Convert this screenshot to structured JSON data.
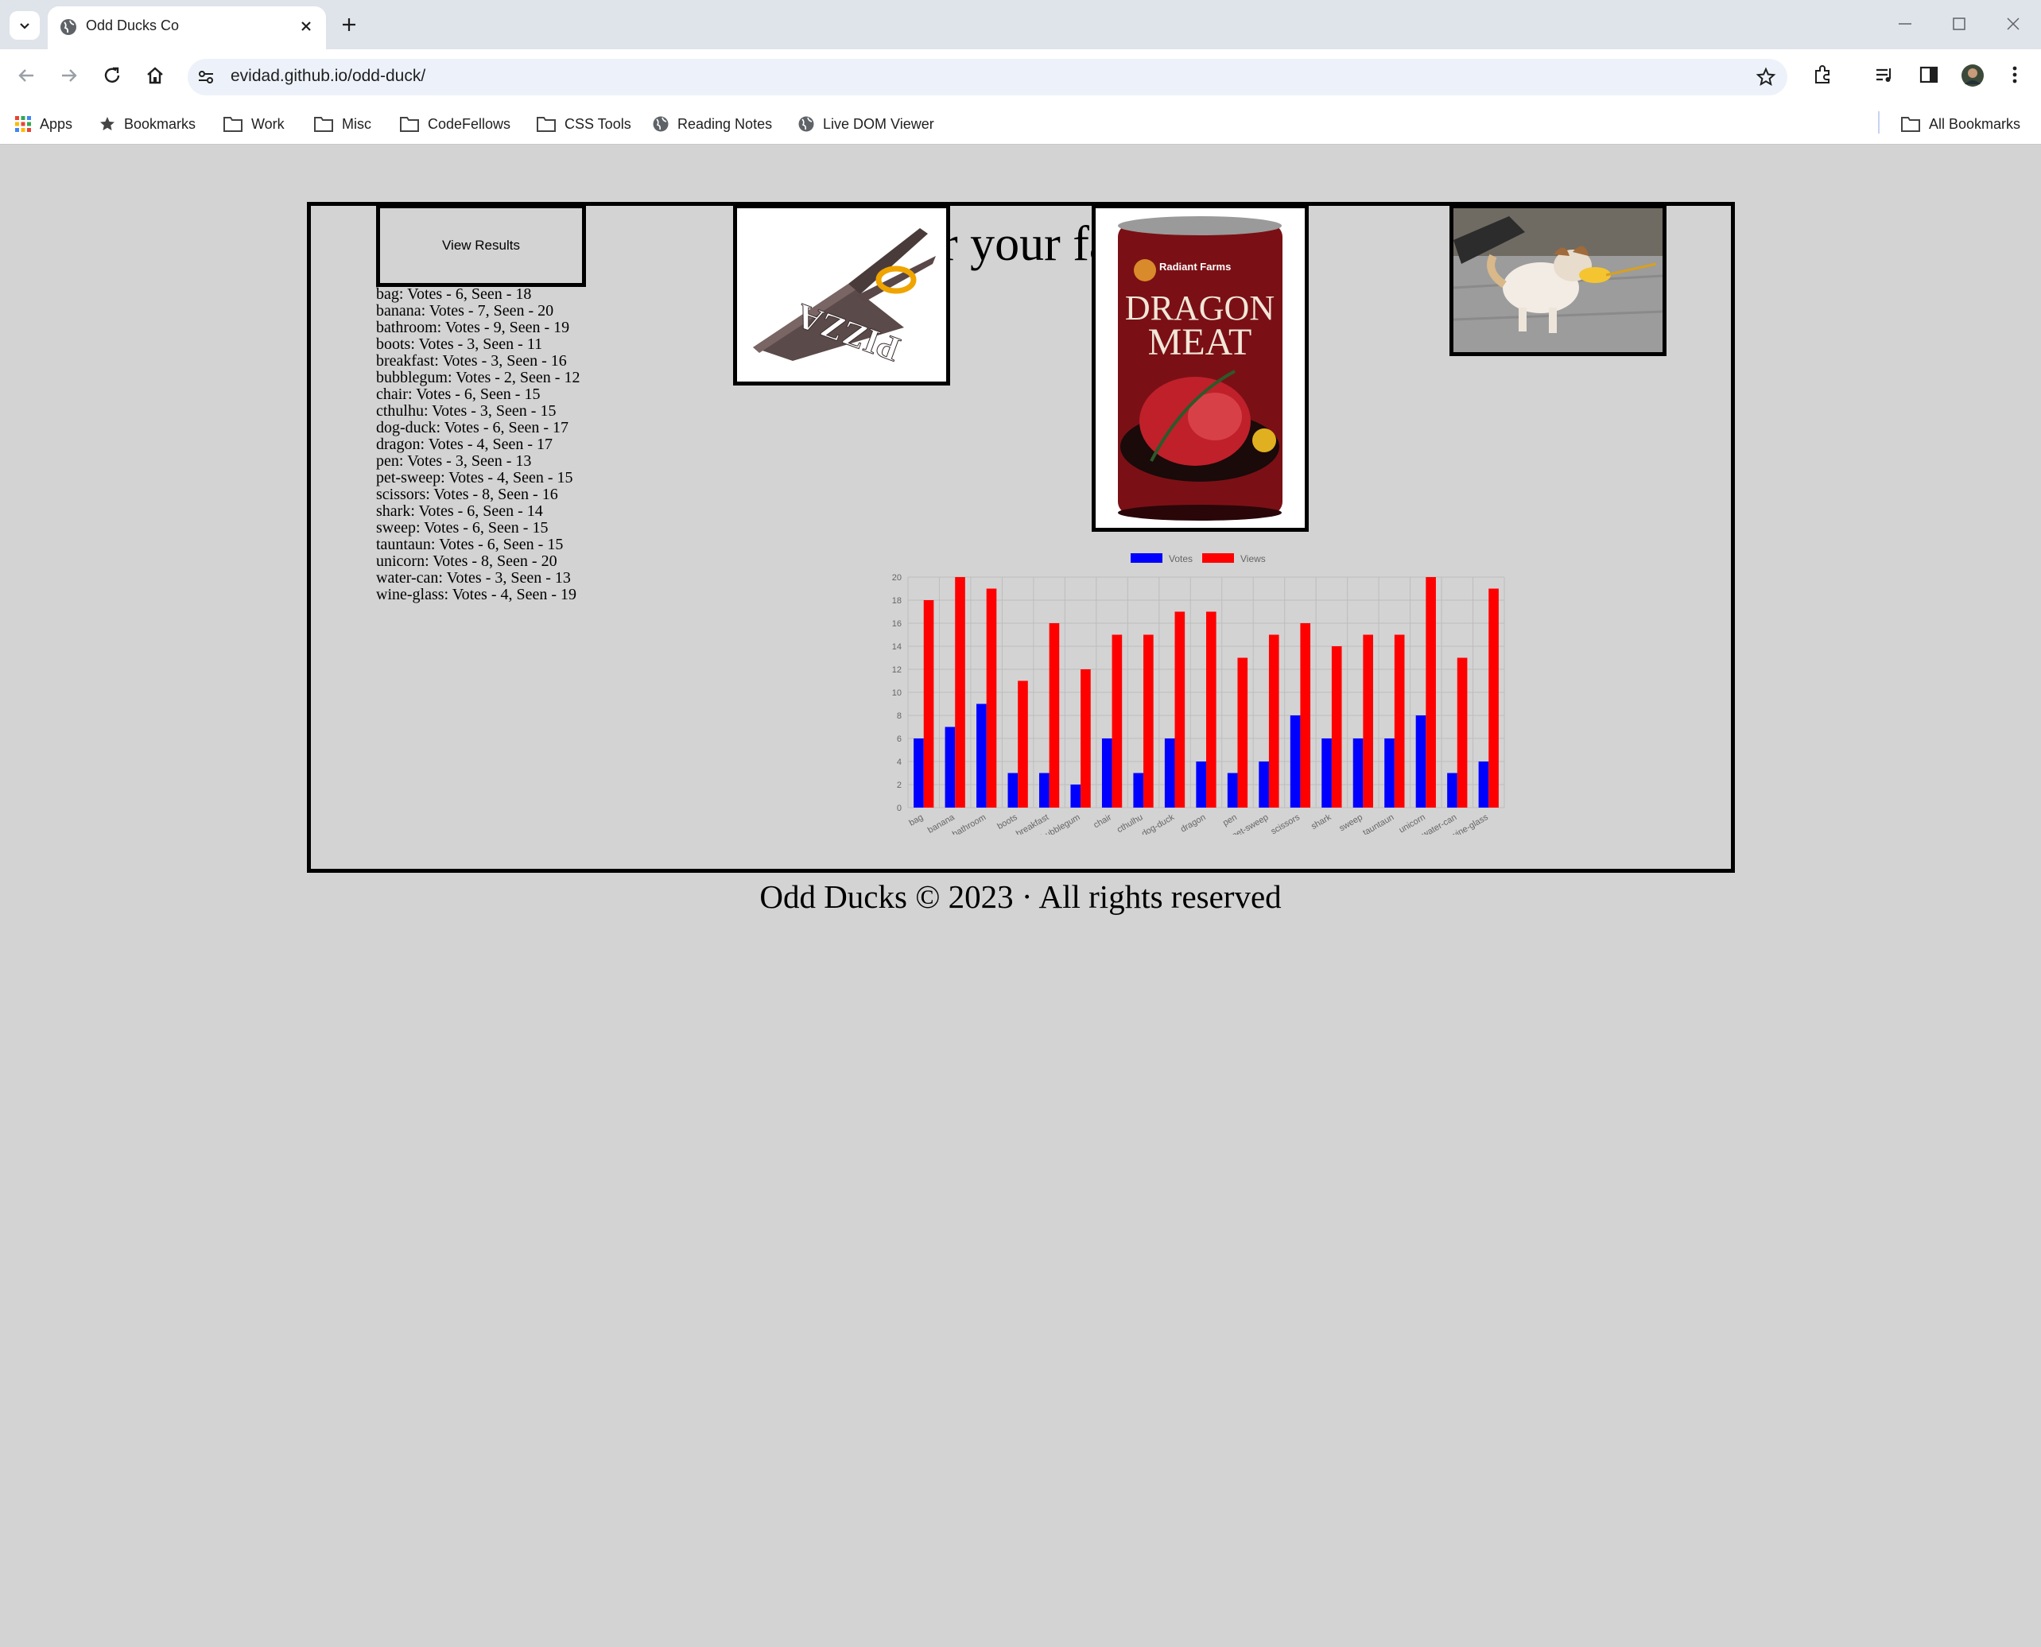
{
  "browser": {
    "tab_title": "Odd Ducks Co",
    "url": "evidad.github.io/odd-duck/",
    "bookmarks": [
      {
        "label": "Apps",
        "icon": "apps-grid-icon"
      },
      {
        "label": "Bookmarks",
        "icon": "star-icon"
      },
      {
        "label": "Work",
        "icon": "folder-icon"
      },
      {
        "label": "Misc",
        "icon": "folder-icon"
      },
      {
        "label": "CodeFellows",
        "icon": "folder-icon"
      },
      {
        "label": "CSS Tools",
        "icon": "folder-icon"
      },
      {
        "label": "Reading Notes",
        "icon": "globe-icon"
      },
      {
        "label": "Live DOM Viewer",
        "icon": "globe-icon"
      }
    ],
    "all_bookmarks": "All Bookmarks"
  },
  "page": {
    "heading": "Vote for your favorite!",
    "results_button": "View Results",
    "footer": "Odd Ducks © 2023 · All rights reserved",
    "results": [
      "bag: Votes - 6, Seen - 18",
      "banana: Votes - 7, Seen - 20",
      "bathroom: Votes - 9, Seen - 19",
      "boots: Votes - 3, Seen - 11",
      "breakfast: Votes - 3, Seen - 16",
      "bubblegum: Votes - 2, Seen - 12",
      "chair: Votes - 6, Seen - 15",
      "cthulhu: Votes - 3, Seen - 15",
      "dog-duck: Votes - 6, Seen - 17",
      "dragon: Votes - 4, Seen - 17",
      "pen: Votes - 3, Seen - 13",
      "pet-sweep: Votes - 4, Seen - 15",
      "scissors: Votes - 8, Seen - 16",
      "shark: Votes - 6, Seen - 14",
      "sweep: Votes - 6, Seen - 15",
      "tauntaun: Votes - 6, Seen - 15",
      "unicorn: Votes - 8, Seen - 20",
      "water-can: Votes - 3, Seen - 13",
      "wine-glass: Votes - 4, Seen - 19"
    ],
    "products": [
      {
        "name": "scissors",
        "text": "PIZZA"
      },
      {
        "name": "dragon",
        "brand": "Radiant Farms",
        "line1": "DRAGON",
        "line2": "MEAT"
      },
      {
        "name": "dog-duck"
      }
    ]
  },
  "colors": {
    "page_bg": "#d3d3d3",
    "votes": "#0000ff",
    "views": "#ff0000"
  },
  "chart_data": {
    "type": "bar",
    "categories": [
      "bag",
      "banana",
      "bathroom",
      "boots",
      "breakfast",
      "bubblegum",
      "chair",
      "cthulhu",
      "dog-duck",
      "dragon",
      "pen",
      "pet-sweep",
      "scissors",
      "shark",
      "sweep",
      "tauntaun",
      "unicorn",
      "water-can",
      "wine-glass"
    ],
    "series": [
      {
        "name": "Votes",
        "color": "#0000ff",
        "values": [
          6,
          7,
          9,
          3,
          3,
          2,
          6,
          3,
          6,
          4,
          3,
          4,
          8,
          6,
          6,
          6,
          8,
          3,
          4
        ]
      },
      {
        "name": "Views",
        "color": "#ff0000",
        "values": [
          18,
          20,
          19,
          11,
          16,
          12,
          15,
          15,
          17,
          17,
          13,
          15,
          16,
          14,
          15,
          15,
          20,
          13,
          19
        ]
      }
    ],
    "yticks": [
      "0",
      "2",
      "4",
      "6",
      "8",
      "10",
      "12",
      "14",
      "16",
      "18",
      "20"
    ],
    "ylim": [
      0,
      20
    ],
    "grid": true,
    "legend": "top"
  }
}
